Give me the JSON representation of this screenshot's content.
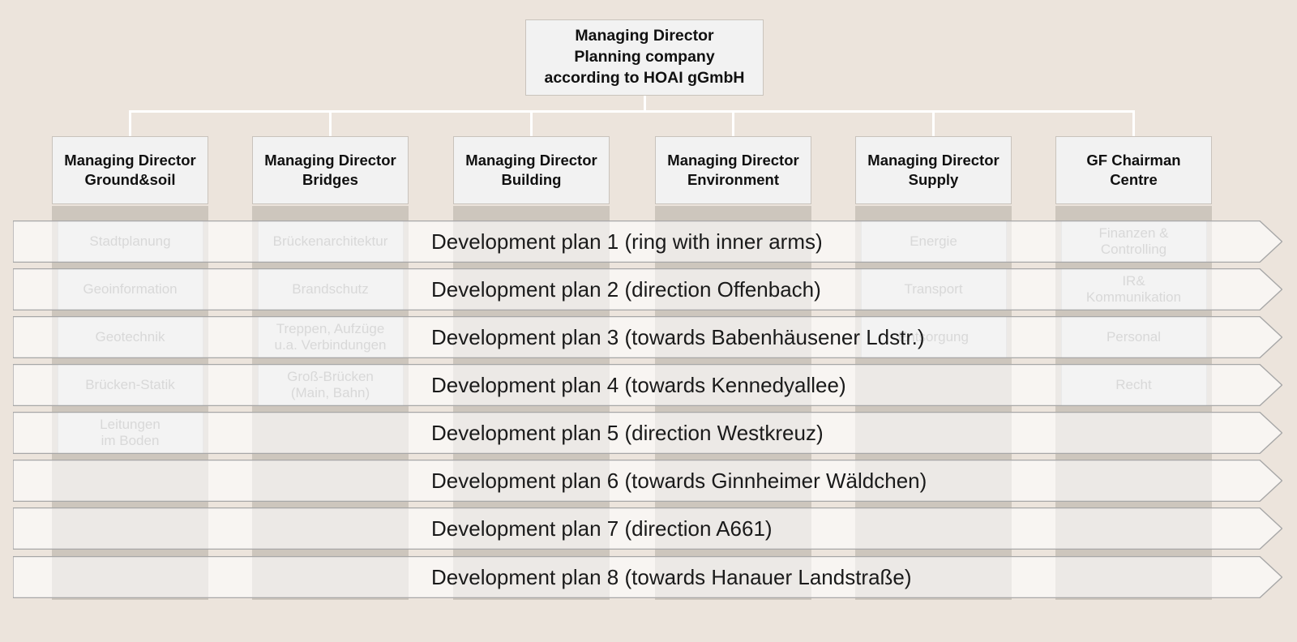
{
  "root": {
    "lines": [
      "Managing Director",
      "Planning company",
      "according to HOAI gGmbH"
    ]
  },
  "departments": [
    {
      "name": "ground-soil",
      "lines": [
        "Managing Director",
        "Ground&soil"
      ]
    },
    {
      "name": "bridges",
      "lines": [
        "Managing Director",
        "Bridges"
      ]
    },
    {
      "name": "building",
      "lines": [
        "Managing Director",
        "Building"
      ]
    },
    {
      "name": "environment",
      "lines": [
        "Managing Director",
        "Environment"
      ]
    },
    {
      "name": "supply",
      "lines": [
        "Managing Director",
        "Supply"
      ]
    },
    {
      "name": "centre",
      "lines": [
        "GF Chairman",
        "Centre"
      ]
    }
  ],
  "subunits": {
    "ground_soil": [
      {
        "lines": [
          "Stadtplanung"
        ]
      },
      {
        "lines": [
          "Geoinformation"
        ]
      },
      {
        "lines": [
          "Geotechnik"
        ]
      },
      {
        "lines": [
          "Brücken-Statik"
        ]
      },
      {
        "lines": [
          "Leitungen",
          "im Boden"
        ]
      }
    ],
    "bridges": [
      {
        "lines": [
          "Brückenarchitektur"
        ]
      },
      {
        "lines": [
          "Brandschutz"
        ]
      },
      {
        "lines": [
          "Treppen, Aufzüge",
          "u.a. Verbindungen"
        ]
      },
      {
        "lines": [
          "Groß-Brücken",
          "(Main, Bahn)"
        ]
      }
    ],
    "building": [],
    "environment": [],
    "supply": [
      {
        "lines": [
          "Energie"
        ]
      },
      {
        "lines": [
          "Transport"
        ]
      },
      {
        "lines": [
          "Entsorgung"
        ]
      }
    ],
    "centre": [
      {
        "lines": [
          "Finanzen &",
          "Controlling"
        ]
      },
      {
        "lines": [
          "IR&",
          "Kommunikation"
        ]
      },
      {
        "lines": [
          "Personal"
        ]
      },
      {
        "lines": [
          "Recht"
        ]
      }
    ]
  },
  "plans": [
    {
      "label": "Development plan 1 (ring with inner arms)"
    },
    {
      "label": "Development plan 2 (direction Offenbach)"
    },
    {
      "label": "Development plan 3 (towards Babenhäusener Ldstr.)"
    },
    {
      "label": "Development plan 4 (towards Kennedyallee)"
    },
    {
      "label": "Development plan 5 (direction Westkreuz)"
    },
    {
      "label": "Development plan 6 (towards Ginnheimer Wäldchen)"
    },
    {
      "label": "Development plan 7 (direction A661)"
    },
    {
      "label": "Development plan 8 (towards Hanauer Landstraße)"
    }
  ],
  "colors": {
    "background": "#ece4dc",
    "box_fill": "#f2f2f2",
    "box_border": "#c9c3bc",
    "column_band": "#cdc6bd",
    "subunit_fill": "#dfdfdf",
    "subunit_border": "#c6c6c6",
    "subunit_text": "#9a9a9a",
    "connector": "#ffffff",
    "plan_border": "#a7a7a7",
    "plan_text": "#1a1a1a"
  }
}
